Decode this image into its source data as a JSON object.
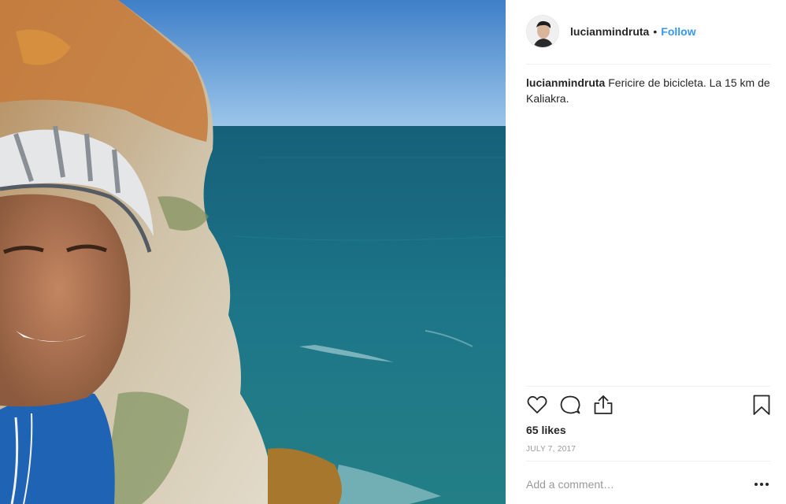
{
  "post": {
    "username": "lucianmindruta",
    "separator": "•",
    "follow_label": "Follow",
    "caption_username": "lucianmindruta",
    "caption_text": " Fericire de bicicleta. La 15 km de Kaliakra.",
    "likes": "65 likes",
    "date": "JULY 7, 2017",
    "comment_placeholder": "Add a comment…"
  },
  "actions": {
    "like_icon": "heart-icon",
    "comment_icon": "speech-bubble-icon",
    "share_icon": "share-icon",
    "save_icon": "bookmark-icon",
    "more_icon": "more-dots-icon"
  },
  "colors": {
    "link": "#3897f0",
    "text": "#262626",
    "muted": "#999999",
    "divider": "#efefef"
  }
}
